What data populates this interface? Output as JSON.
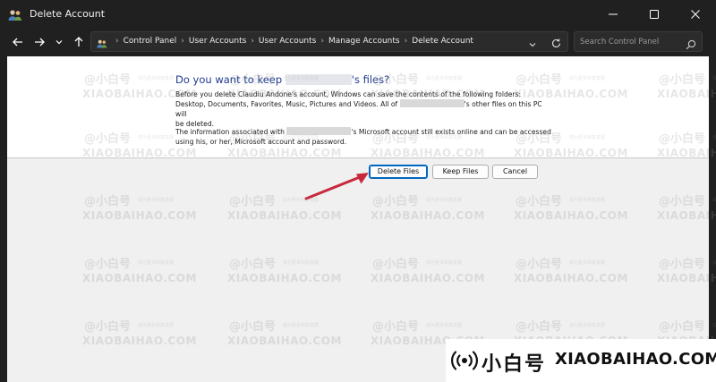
{
  "window": {
    "title": "Delete Account"
  },
  "nav": {
    "breadcrumbs": [
      "Control Panel",
      "User Accounts",
      "User Accounts",
      "Manage Accounts",
      "Delete Account"
    ],
    "search_placeholder": "Search Control Panel"
  },
  "dialog": {
    "heading_prefix": "Do you want to keep",
    "heading_suffix": "'s files?",
    "p1_part1": "Before you delete Claudiu Andone's account, Windows can save the contents of the following folders:",
    "p1_part2": "Desktop, Documents, Favorites, Music, Pictures and Videos. All of",
    "p1_part3": "'s other files on this PC will",
    "p1_part4": "be deleted.",
    "p2_part1": "The information associated with",
    "p2_part2": "'s Microsoft account still exists online and can be accessed",
    "p2_part3": "using his, or her, Microsoft account and password."
  },
  "buttons": {
    "delete": "Delete Files",
    "keep": "Keep Files",
    "cancel": "Cancel"
  },
  "watermark": {
    "cn": "@小白号",
    "en": "XIAOBAIHAO.COM",
    "small": "成为更多科技发展"
  },
  "brand": {
    "cn": "小白号",
    "en": "XIAOBAIHAO.COM"
  },
  "colors": {
    "heading": "#1f3a8f",
    "accent": "#0067c0",
    "arrow": "#c8283c"
  }
}
